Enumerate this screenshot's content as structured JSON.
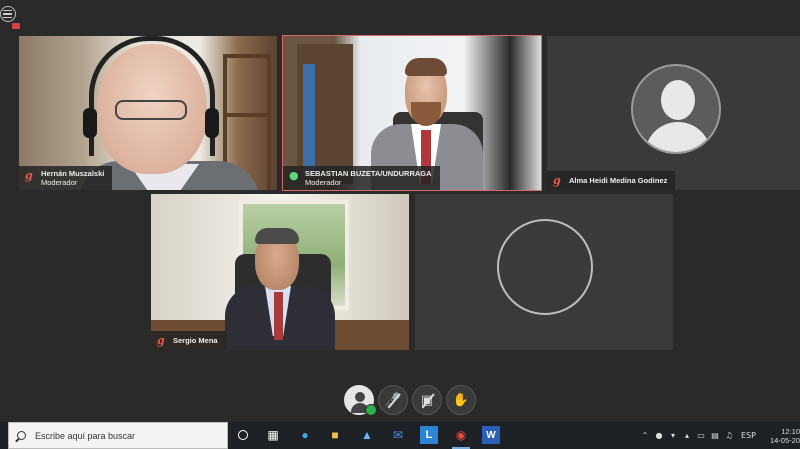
{
  "participants": [
    {
      "name": "Hernán Muszalski",
      "role": "Moderador"
    },
    {
      "name": "SEBASTIAN BUZETA/UNDURRAGA",
      "role": "Moderador"
    },
    {
      "name": "Alma Heidi Medina Godinez",
      "role": ""
    },
    {
      "name": "Sergio Mena",
      "role": ""
    }
  ],
  "controls": {
    "self": "self-view",
    "mic": "microphone-off",
    "camera": "camera-off",
    "hand": "raise-hand"
  },
  "taskbar": {
    "search_placeholder": "Escribe aquí para buscar",
    "language": "ESP",
    "time": "12:10",
    "date": "14-05-20"
  },
  "colors": {
    "active_speaker_border": "#d8686b",
    "logo_red": "#e35a4b",
    "taskbar_bg": "#1d2025"
  }
}
